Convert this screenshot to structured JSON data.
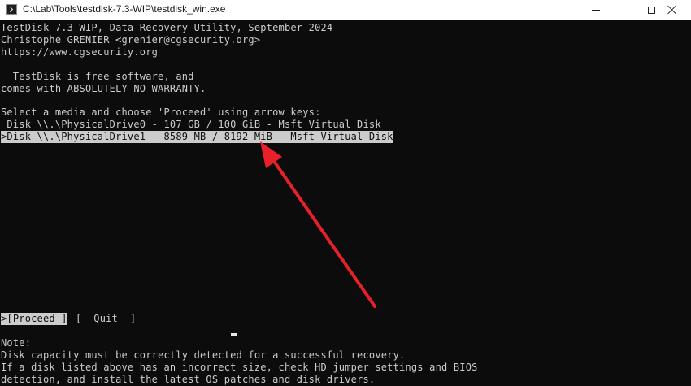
{
  "window": {
    "title": "C:\\Lab\\Tools\\testdisk-7.3-WIP\\testdisk_win.exe"
  },
  "terminal": {
    "header": [
      "TestDisk 7.3-WIP, Data Recovery Utility, September 2024",
      "Christophe GRENIER <grenier@cgsecurity.org>",
      "https://www.cgsecurity.org"
    ],
    "license": [
      "  TestDisk is free software, and",
      "comes with ABSOLUTELY NO WARRANTY."
    ],
    "prompt": "Select a media and choose 'Proceed' using arrow keys:",
    "disks": [
      " Disk \\\\.\\PhysicalDrive0 - 107 GB / 100 GiB - Msft Virtual Disk",
      ">Disk \\\\.\\PhysicalDrive1 - 8589 MB / 8192 MiB - Msft Virtual Disk"
    ],
    "selected_disk_index": 1,
    "actions": {
      "proceed": ">[Proceed ]",
      "quit": "[  Quit  ]"
    },
    "note": [
      "Note:",
      "Disk capacity must be correctly detected for a successful recovery.",
      "If a disk listed above has an incorrect size, check HD jumper settings and BIOS",
      "detection, and install the latest OS patches and disk drivers."
    ]
  },
  "colors": {
    "terminal_bg": "#0c0c0c",
    "terminal_fg": "#cccccc",
    "annotation_arrow": "#e8202a"
  }
}
